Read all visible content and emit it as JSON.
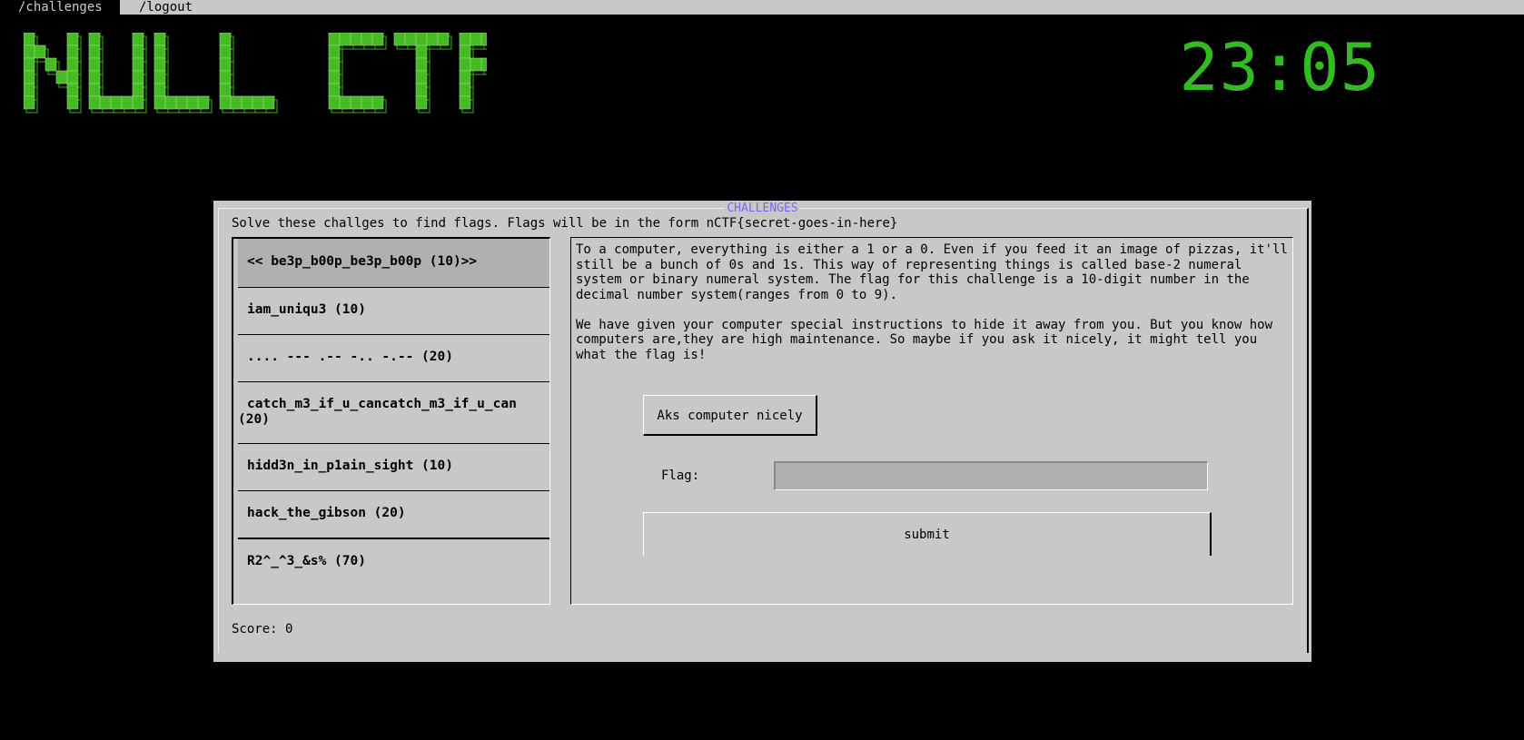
{
  "nav": {
    "challenges": "/challenges",
    "logout": "/logout"
  },
  "logo": {
    "text": "NULL CTF"
  },
  "clock": "23:05",
  "panel": {
    "title": "CHALLENGES",
    "intro": "Solve these challges to find flags. Flags will be in the form nCTF{secret-goes-in-here}",
    "challenges": [
      {
        "label": "<< be3p_b00p_be3p_b00p (10)>>",
        "selected": true
      },
      {
        "label": "iam_uniqu3 (10)"
      },
      {
        "label": ".... --- .-- -.. -.-- (20)"
      },
      {
        "label": "catch_m3_if_u_cancatch_m3_if_u_can (20)"
      },
      {
        "label": "hidd3n_in_p1ain_sight (10)"
      },
      {
        "label": "hack_the_gibson (20)"
      },
      {
        "label": "R2^_^3_&s% (70)"
      }
    ],
    "description": "To a computer, everything is either a 1 or a 0. Even if you feed it an image of pizzas, it'll\nstill be a bunch of 0s and 1s. This way of representing things is called base-2 numeral\nsystem or binary numeral system. The flag for this challenge is a 10-digit number in the\ndecimal number system(ranges from 0 to 9).\n\nWe have given your computer special instructions to hide it away from you. But you know how\ncomputers are,they are high maintenance. So maybe if you ask it nicely, it might tell you\nwhat the flag is!",
    "ask_button": "Aks computer nicely",
    "flag_label": "Flag:",
    "flag_value": "",
    "submit_button": "submit",
    "score_label": "Score:",
    "score_value": "0"
  },
  "colors": {
    "background": "#000000",
    "accent_green": "#33bb22",
    "panel": "#c8c8c8",
    "title": "#7b68ee"
  }
}
